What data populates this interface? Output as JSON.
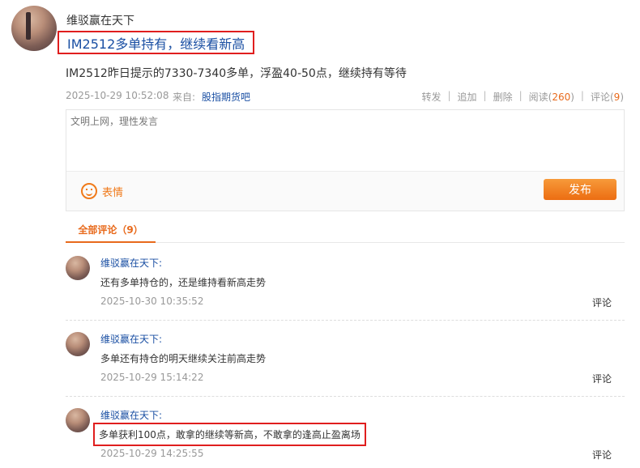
{
  "post": {
    "author": "维驳赢在天下",
    "title": "IM2512多单持有，继续看新高",
    "body": "IM2512昨日提示的7330-7340多单，浮盈40-50点，继续持有等待",
    "time": "2025-10-29 10:52:08",
    "from_label": "来自:",
    "source": "股指期货吧",
    "actions": {
      "forward": "转发",
      "append": "追加",
      "delete": "删除",
      "read_label": "阅读",
      "read_count": "260",
      "comment_label": "评论",
      "comment_count": "9"
    }
  },
  "editor": {
    "placeholder": "文明上网，理性发言",
    "emoji_label": "表情",
    "publish_label": "发布"
  },
  "tabs": {
    "all_comments": "全部评论（9）"
  },
  "comments": [
    {
      "author": "维驳赢在天下:",
      "text": "还有多单持仓的，还是维持看新高走势",
      "time": "2025-10-30 10:35:52",
      "reply": "评论"
    },
    {
      "author": "维驳赢在天下:",
      "text": "多单还有持仓的明天继续关注前高走势",
      "time": "2025-10-29 15:14:22",
      "reply": "评论"
    },
    {
      "author": "维驳赢在天下:",
      "text": "多单获利100点，敢拿的继续等新高，不敢拿的逢高止盈离场",
      "time": "2025-10-29 14:25:55",
      "reply": "评论"
    }
  ],
  "colors": {
    "accent": "#e86a1c",
    "link": "#1a4fa3",
    "highlight_border": "#e01e1e"
  }
}
